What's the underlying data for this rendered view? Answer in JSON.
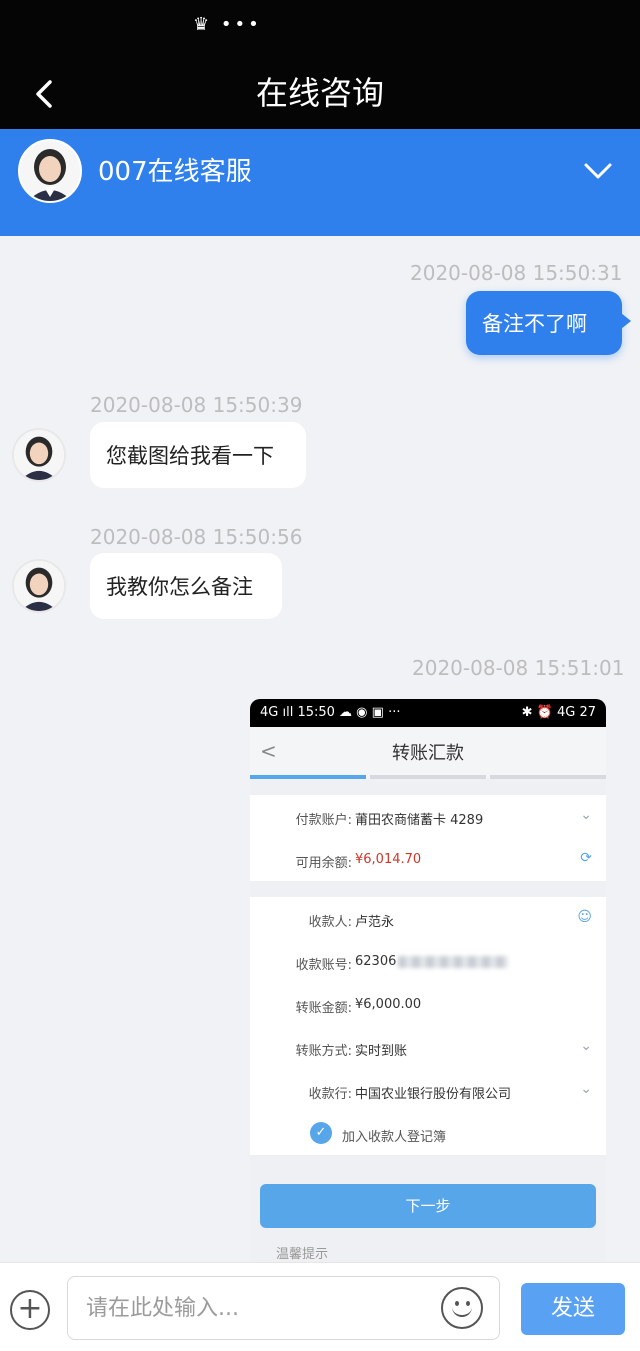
{
  "status_bar": {
    "icons": "♛ •••"
  },
  "header": {
    "title": "在线咨询",
    "back_icon": "chevron-left-icon"
  },
  "agent": {
    "name": "007在线客服",
    "collapse_icon": "chevron-down-icon"
  },
  "messages": [
    {
      "timestamp": "2020-08-08 15:50:31",
      "side": "me",
      "text": "备注不了啊"
    },
    {
      "timestamp": "2020-08-08 15:50:39",
      "side": "agent",
      "text": "您截图给我看一下"
    },
    {
      "timestamp": "2020-08-08 15:50:56",
      "side": "agent",
      "text": "我教你怎么备注"
    },
    {
      "timestamp": "2020-08-08 15:51:01",
      "side": "me",
      "type": "image"
    }
  ],
  "screenshot": {
    "status_time": "15:50",
    "status_left": "4G ıll 15:50 ☁ ◉ ▣ ···",
    "status_right": "✱ ⏰ 4G 27",
    "back": "<",
    "title": "转账汇款",
    "rows_group1": [
      {
        "label": "付款账户:",
        "value": "莆田农商储蓄卡 4289",
        "icon": "chevron-down-icon"
      },
      {
        "label": "可用余额:",
        "value": "¥6,014.70",
        "icon": "refresh-icon"
      }
    ],
    "rows_group2": [
      {
        "label": "收款人:",
        "value": "卢范永",
        "icon": "contacts-icon"
      },
      {
        "label": "收款账号:",
        "value": "62306",
        "icon": ""
      },
      {
        "label": "转账金额:",
        "value": "¥6,000.00",
        "icon": ""
      },
      {
        "label": "转账方式:",
        "value": "实时到账",
        "icon": "chevron-down-icon"
      },
      {
        "label": "收款行:",
        "value": "中国农业银行股份有限公司",
        "icon": "chevron-down-icon"
      }
    ],
    "checkbox_label": "加入收款人登记簿",
    "next_button": "下一步",
    "tips": "温馨提示"
  },
  "input": {
    "placeholder": "请在此处输入...",
    "value": "",
    "send_label": "发送",
    "plus_icon": "plus-circle-icon",
    "emoji_icon": "smile-icon"
  },
  "colors": {
    "brand_blue": "#2f80ec",
    "send_blue": "#58a1f3",
    "amount_red": "#d0352a"
  }
}
